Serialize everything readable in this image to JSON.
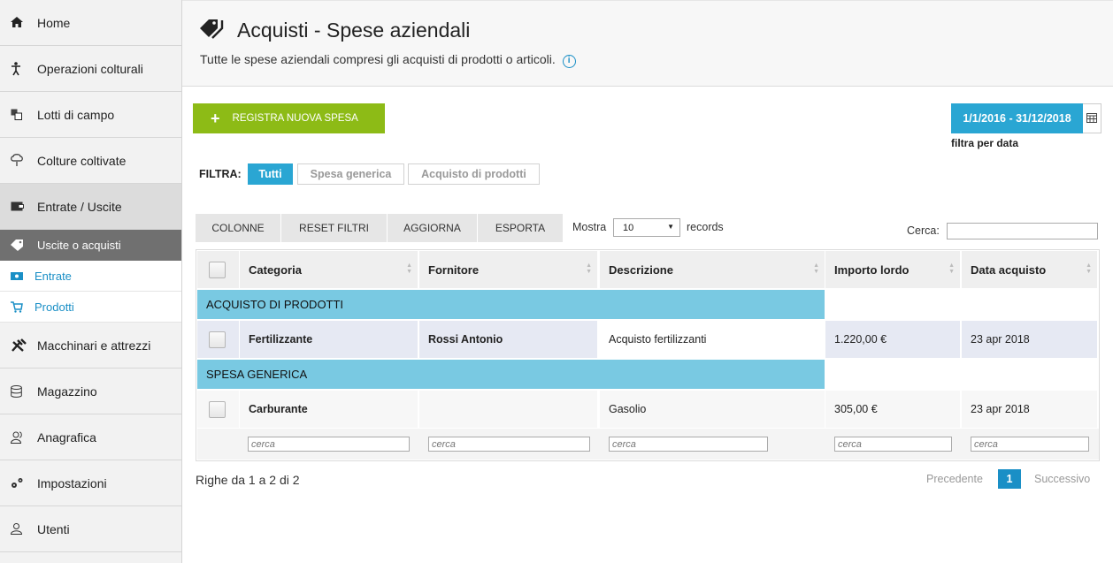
{
  "sidebar": {
    "items_top": [
      {
        "label": "Home",
        "icon": "home-icon"
      },
      {
        "label": "Operazioni colturali",
        "icon": "person-icon"
      },
      {
        "label": "Lotti di campo",
        "icon": "layers-icon"
      },
      {
        "label": "Colture coltivate",
        "icon": "plant-icon"
      },
      {
        "label": "Entrate / Uscite",
        "icon": "wallet-icon"
      }
    ],
    "sub_active": {
      "label": "Uscite o acquisti",
      "icon": "tag-icon"
    },
    "sub_items": [
      {
        "label": "Entrate",
        "icon": "money-icon"
      },
      {
        "label": "Prodotti",
        "icon": "cart-icon"
      }
    ],
    "items_bottom": [
      {
        "label": "Macchinari e attrezzi",
        "icon": "tools-icon"
      },
      {
        "label": "Magazzino",
        "icon": "database-icon"
      },
      {
        "label": "Anagrafica",
        "icon": "contacts-icon"
      },
      {
        "label": "Impostazioni",
        "icon": "settings-icon"
      },
      {
        "label": "Utenti",
        "icon": "user-icon"
      }
    ]
  },
  "header": {
    "title": "Acquisti - Spese aziendali",
    "subtitle": "Tutte le spese aziendali compresi gli acquisti di prodotti o articoli."
  },
  "actions": {
    "new_expense": "REGISTRA NUOVA SPESA",
    "date_range": "1/1/2016 - 31/12/2018",
    "date_note": "filtra per data"
  },
  "filter": {
    "label": "FILTRA:",
    "chips": [
      "Tutti",
      "Spesa generica",
      "Acquisto di prodotti"
    ],
    "active": "Tutti"
  },
  "toolbar": {
    "buttons": [
      "COLONNE",
      "RESET FILTRI",
      "AGGIORNA",
      "ESPORTA"
    ],
    "show_label": "Mostra",
    "show_value": "10",
    "records_label": "records",
    "search_label": "Cerca:"
  },
  "table": {
    "columns": [
      "Categoria",
      "Fornitore",
      "Descrizione",
      "Importo lordo",
      "Data acquisto"
    ],
    "groups": [
      {
        "title": "ACQUISTO DI PRODOTTI",
        "rows": [
          {
            "categoria": "Fertilizzante",
            "fornitore": "Rossi Antonio",
            "descrizione": "Acquisto fertilizzanti",
            "importo": "1.220,00 €",
            "data": "23 apr 2018"
          }
        ]
      },
      {
        "title": "SPESA GENERICA",
        "rows": [
          {
            "categoria": "Carburante",
            "fornitore": "",
            "descrizione": "Gasolio",
            "importo": "305,00 €",
            "data": "23 apr 2018"
          }
        ]
      }
    ],
    "filter_placeholder": "cerca"
  },
  "footer": {
    "rows_info": "Righe da 1 a 2 di 2",
    "prev": "Precedente",
    "current_page": "1",
    "next": "Successivo"
  }
}
